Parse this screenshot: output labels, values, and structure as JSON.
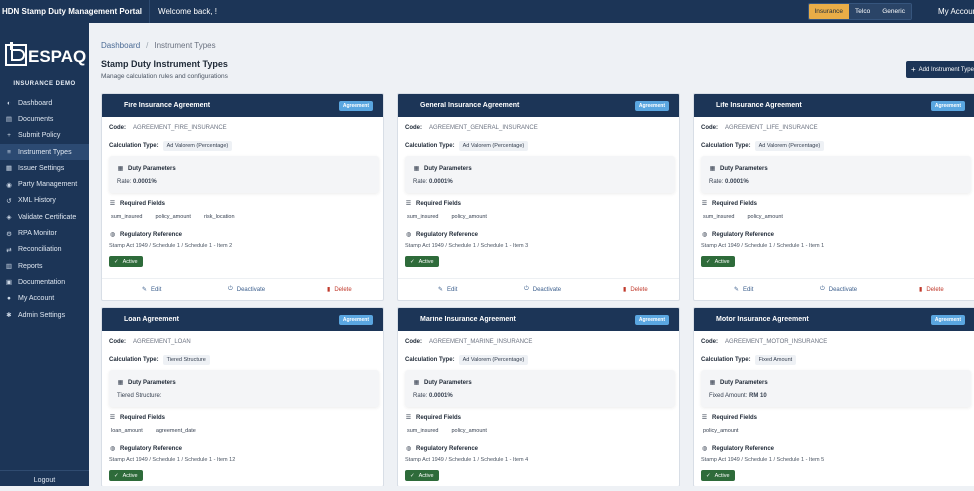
{
  "topbar": {
    "brand": "HDN Stamp Duty Management Portal",
    "welcome": "Welcome back, !",
    "modes": [
      {
        "label": "Insurance",
        "active": true
      },
      {
        "label": "Telco",
        "active": false
      },
      {
        "label": "Generic",
        "active": false
      }
    ],
    "account": "My Account"
  },
  "sidebar": {
    "logo_text": "ESPAQ",
    "tenant": "INSURANCE DEMO",
    "items": [
      {
        "label": "Dashboard",
        "icon": "gauge-icon",
        "glyph": "◐"
      },
      {
        "label": "Documents",
        "icon": "document-icon",
        "glyph": "▤"
      },
      {
        "label": "Submit Policy",
        "icon": "plus-icon",
        "glyph": "+"
      },
      {
        "label": "Instrument Types",
        "icon": "list-icon",
        "glyph": "≡",
        "active": true
      },
      {
        "label": "Issuer Settings",
        "icon": "building-icon",
        "glyph": "▦"
      },
      {
        "label": "Party Management",
        "icon": "users-icon",
        "glyph": "◉"
      },
      {
        "label": "XML History",
        "icon": "history-icon",
        "glyph": "↺"
      },
      {
        "label": "Validate Certificate",
        "icon": "shield-check-icon",
        "glyph": "◈"
      },
      {
        "label": "RPA Monitor",
        "icon": "robot-icon",
        "glyph": "⚙"
      },
      {
        "label": "Reconciliation",
        "icon": "balance-icon",
        "glyph": "⇄"
      },
      {
        "label": "Reports",
        "icon": "chart-icon",
        "glyph": "▥"
      },
      {
        "label": "Documentation",
        "icon": "book-icon",
        "glyph": "▣"
      },
      {
        "label": "My Account",
        "icon": "user-icon",
        "glyph": "●"
      },
      {
        "label": "Admin Settings",
        "icon": "gear-icon",
        "glyph": "✱"
      }
    ],
    "logout": "Logout"
  },
  "page": {
    "breadcrumb_home": "Dashboard",
    "breadcrumb_current": "Instrument Types",
    "title": "Stamp Duty Instrument Types",
    "subtitle": "Manage calculation rules and configurations",
    "add_button": "Add Instrument Type"
  },
  "labels": {
    "code": "Code:",
    "calc_type": "Calculation Type:",
    "duty_params": "Duty Parameters",
    "required_fields": "Required Fields",
    "reg_ref": "Regulatory Reference",
    "edit": "Edit",
    "deactivate": "Deactivate",
    "delete": "Delete"
  },
  "cards": [
    {
      "name": "Fire Insurance Agreement",
      "badge": "Agreement",
      "code": "AGREEMENT_FIRE_INSURANCE",
      "calc": "Ad Valorem (Percentage)",
      "param_label": "Rate:",
      "param_value": "0.0001%",
      "fields": [
        "sum_insured",
        "policy_amount",
        "risk_location"
      ],
      "reference": "Stamp Act 1949 / Schedule 1 / Schedule 1 - Item 2",
      "status": "Active"
    },
    {
      "name": "General Insurance Agreement",
      "badge": "Agreement",
      "code": "AGREEMENT_GENERAL_INSURANCE",
      "calc": "Ad Valorem (Percentage)",
      "param_label": "Rate:",
      "param_value": "0.0001%",
      "fields": [
        "sum_insured",
        "policy_amount"
      ],
      "reference": "Stamp Act 1949 / Schedule 1 / Schedule 1 - Item 3",
      "status": "Active"
    },
    {
      "name": "Life Insurance Agreement",
      "badge": "Agreement",
      "code": "AGREEMENT_LIFE_INSURANCE",
      "calc": "Ad Valorem (Percentage)",
      "param_label": "Rate:",
      "param_value": "0.0001%",
      "fields": [
        "sum_insured",
        "policy_amount"
      ],
      "reference": "Stamp Act 1949 / Schedule 1 / Schedule 1 - Item 1",
      "status": "Active"
    },
    {
      "name": "Loan Agreement",
      "badge": "Agreement",
      "code": "AGREEMENT_LOAN",
      "calc": "Tiered Structure",
      "param_label": "Tiered Structure:",
      "param_value": "",
      "fields": [
        "loan_amount",
        "agreement_date"
      ],
      "reference": "Stamp Act 1949 / Schedule 1 / Schedule 1 - Item 12",
      "status": "Active"
    },
    {
      "name": "Marine Insurance Agreement",
      "badge": "Agreement",
      "code": "AGREEMENT_MARINE_INSURANCE",
      "calc": "Ad Valorem (Percentage)",
      "param_label": "Rate:",
      "param_value": "0.0001%",
      "fields": [
        "sum_insured",
        "policy_amount"
      ],
      "reference": "Stamp Act 1949 / Schedule 1 / Schedule 1 - Item 4",
      "status": "Active"
    },
    {
      "name": "Motor Insurance Agreement",
      "badge": "Agreement",
      "code": "AGREEMENT_MOTOR_INSURANCE",
      "calc": "Fixed Amount",
      "param_label": "Fixed Amount:",
      "param_value": "RM 10",
      "fields": [
        "policy_amount"
      ],
      "reference": "Stamp Act 1949 / Schedule 1 / Schedule 1 - Item 5",
      "status": "Active"
    }
  ],
  "colors": {
    "navy": "#1c3557",
    "accent": "#e9ad47",
    "badge": "#5aa6e0",
    "active": "#2e6b3a",
    "danger": "#c0392b"
  }
}
